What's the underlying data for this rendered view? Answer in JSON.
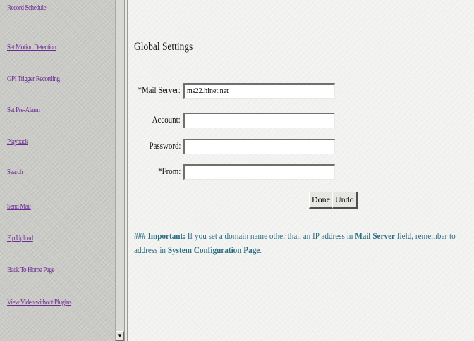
{
  "sidebar": {
    "items": [
      {
        "label": "Record Schedule"
      },
      {
        "label": "Set Motion Detection"
      },
      {
        "label": "GPI Trigger Recording"
      },
      {
        "label": "Set Pre-Alarm"
      },
      {
        "label": "Playback"
      },
      {
        "label": "Search"
      },
      {
        "label": "Send Mail"
      },
      {
        "label": "Ftp Upload"
      },
      {
        "label": "Back To Home Page"
      },
      {
        "label": "View Video without Plugins"
      }
    ]
  },
  "main": {
    "title": "Global Settings",
    "form": {
      "mail_server": {
        "label": "*Mail Server:",
        "value": "ms22.hinet.net"
      },
      "account": {
        "label": "Account:",
        "value": ""
      },
      "password": {
        "label": "Password:",
        "value": ""
      },
      "from": {
        "label": "*From:",
        "value": ""
      }
    },
    "buttons": {
      "done": "Done",
      "undo": "Undo"
    },
    "note": {
      "prefix": "### Important:",
      "text1": " If you set a domain name other than an IP address in ",
      "field": "Mail Server",
      "text2": " field, remember to",
      "line2_text": "address in ",
      "line2_link": "System Configuration Page",
      "line2_end": "."
    }
  },
  "colors": {
    "link": "#6d2b96",
    "note": "#2b6e84"
  },
  "icons": {
    "scroll_down": "triangle-down"
  }
}
